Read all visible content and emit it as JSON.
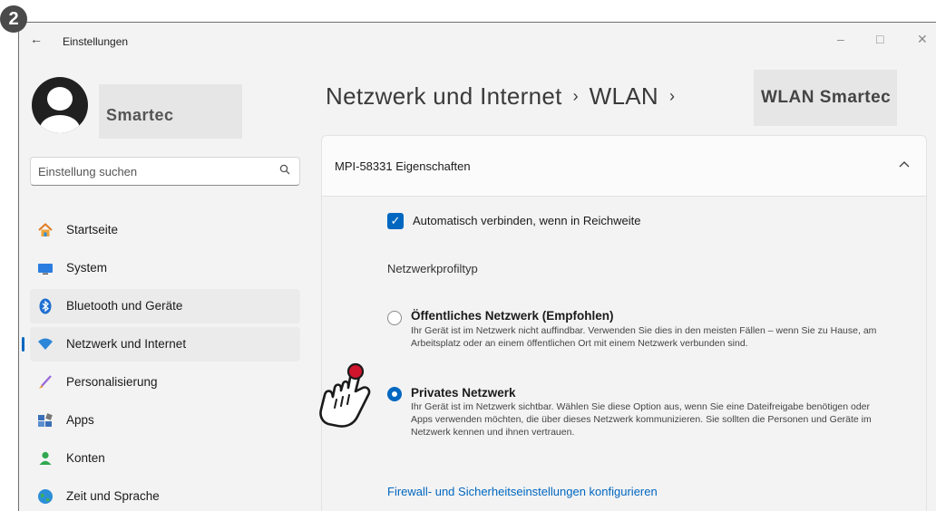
{
  "step_badge": "2",
  "window": {
    "title": "Einstellungen",
    "back": "←",
    "controls": {
      "minimize": "–",
      "maximize": "□",
      "close": "✕"
    }
  },
  "user": {
    "name": "Smartec"
  },
  "search": {
    "placeholder": "Einstellung suchen",
    "icon": "search-icon"
  },
  "nav": [
    {
      "label": "Startseite",
      "icon": "home-icon"
    },
    {
      "label": "System",
      "icon": "system-icon"
    },
    {
      "label": "Bluetooth und Geräte",
      "icon": "bluetooth-icon"
    },
    {
      "label": "Netzwerk und Internet",
      "icon": "wifi-icon",
      "selected": true
    },
    {
      "label": "Personalisierung",
      "icon": "brush-icon"
    },
    {
      "label": "Apps",
      "icon": "apps-icon"
    },
    {
      "label": "Konten",
      "icon": "accounts-icon"
    },
    {
      "label": "Zeit und Sprache",
      "icon": "globe-icon"
    }
  ],
  "breadcrumb": {
    "part1": "Netzwerk und Internet",
    "sep": "›",
    "part2": "WLAN",
    "part3": "WLAN Smartec"
  },
  "card": {
    "title": "MPI-58331 Eigenschaften",
    "chevron": "⌃",
    "auto_connect": {
      "label": "Automatisch verbinden, wenn in Reichweite",
      "checked": true
    },
    "profile_type_label": "Netzwerkprofiltyp",
    "options": [
      {
        "title": "Öffentliches Netzwerk (Empfohlen)",
        "description": "Ihr Gerät ist im Netzwerk nicht auffindbar. Verwenden Sie dies in den meisten Fällen – wenn Sie zu Hause, am Arbeitsplatz oder an einem öffentlichen Ort mit einem Netzwerk verbunden sind.",
        "selected": false
      },
      {
        "title": "Privates Netzwerk",
        "description": "Ihr Gerät ist im Netzwerk sichtbar. Wählen Sie diese Option aus, wenn Sie eine Dateifreigabe benötigen oder Apps verwenden möchten, die über dieses Netzwerk kommunizieren. Sie sollten die Personen und Geräte im Netzwerk kennen und ihnen vertrauen.",
        "selected": true
      }
    ],
    "firewall_link": "Firewall- und Sicherheitseinstellungen konfigurieren"
  },
  "colors": {
    "accent": "#0067c0",
    "pointer_tip": "#d0142c"
  }
}
